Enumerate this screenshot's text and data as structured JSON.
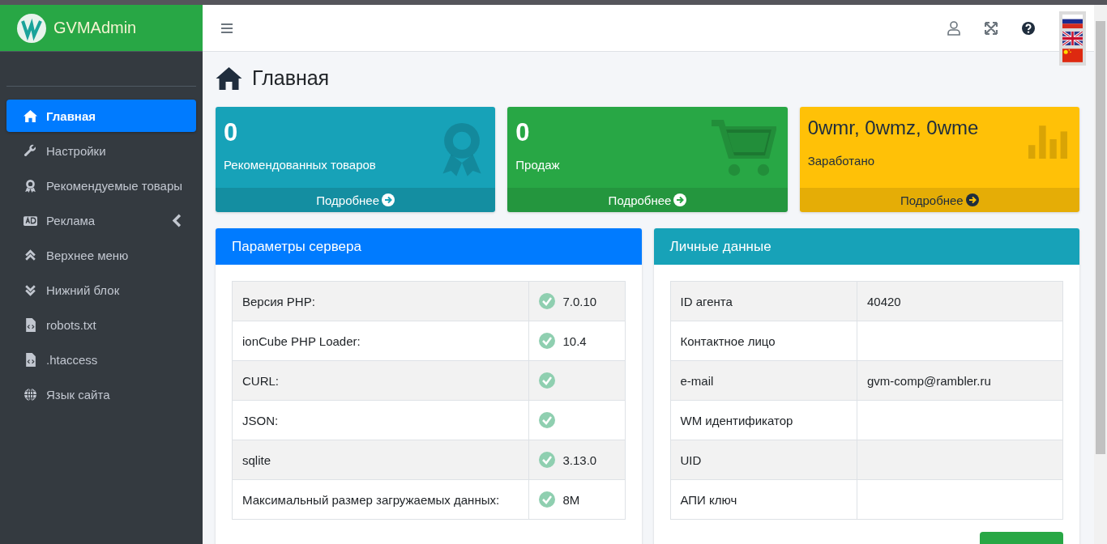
{
  "brand": {
    "name": "GVMAdmin"
  },
  "sidebar": {
    "items": [
      {
        "label": "Главная",
        "kind": "link",
        "selected": true
      },
      {
        "label": "Настройки",
        "kind": "link",
        "selected": false
      },
      {
        "label": "Рекомендуемые товары",
        "kind": "link",
        "selected": false
      },
      {
        "label": "Реклама",
        "kind": "group",
        "selected": false,
        "expanded": false
      },
      {
        "label": "Верхнее меню",
        "kind": "link",
        "selected": false
      },
      {
        "label": "Нижний блок",
        "kind": "link",
        "selected": false
      },
      {
        "label": "robots.txt",
        "kind": "link",
        "selected": false
      },
      {
        "label": ".htaccess",
        "kind": "link",
        "selected": false
      },
      {
        "label": "Язык сайта",
        "kind": "link",
        "selected": false
      }
    ]
  },
  "page": {
    "title": "Главная"
  },
  "stat_boxes": [
    {
      "value": "0",
      "label": "Рекомендованных товаров",
      "link": "Подробнее",
      "kind": "info",
      "color": "#17a2b8"
    },
    {
      "value": "0",
      "label": "Продаж",
      "link": "Подробнее",
      "kind": "success",
      "color": "#28a745"
    },
    {
      "value": "0wmr, 0wmz, 0wme",
      "label": "Заработано",
      "link": "Подробнее",
      "kind": "warning",
      "color": "#ffc107"
    }
  ],
  "server_card": {
    "title": "Параметры сервера",
    "color": "#007bff",
    "rows": [
      {
        "label": "Версия PHP:",
        "ok": true,
        "value": "7.0.10"
      },
      {
        "label": "ionCube PHP Loader:",
        "ok": true,
        "value": "10.4"
      },
      {
        "label": "CURL:",
        "ok": true
      },
      {
        "label": "JSON:",
        "ok": true
      },
      {
        "label": "sqlite",
        "ok": true,
        "value": "3.13.0"
      },
      {
        "label": "Максимальный размер загружаемых данных:",
        "ok": true,
        "value": "8M"
      }
    ]
  },
  "personal_card": {
    "title": "Личные данные",
    "color": "#17a2b8",
    "rows": [
      {
        "label": "ID агента",
        "value": "40420"
      },
      {
        "label": "Контактное лицо"
      },
      {
        "label": "e-mail",
        "value": "gvm-comp@rambler.ru"
      },
      {
        "label": "WM идентификатор"
      },
      {
        "label": "UID"
      },
      {
        "label": "АПИ ключ"
      }
    ]
  }
}
